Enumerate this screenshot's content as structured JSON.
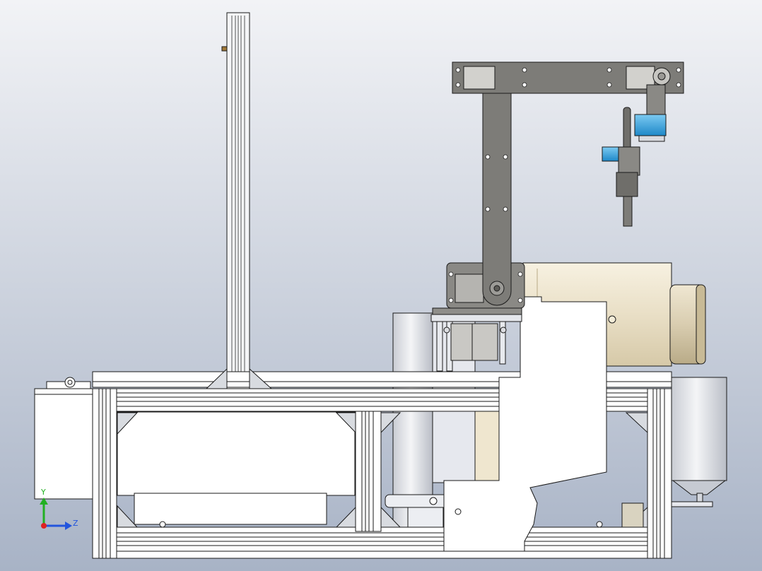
{
  "scene": {
    "background_top": "#f2f3f6",
    "background_bottom": "#a8b3c6",
    "frame_color": "#ffffff",
    "outline_color": "#1a1a1a",
    "arm_color": "#7d7c78",
    "motor_color": "#ece4cf",
    "servo_color": "#2f9fe0",
    "cylinder_color": "#dfe2e8"
  },
  "triad": {
    "y_label": "Y",
    "z_label": "Z",
    "y_color": "#22b022",
    "z_color": "#2255dd",
    "origin_color": "#dd2222"
  }
}
